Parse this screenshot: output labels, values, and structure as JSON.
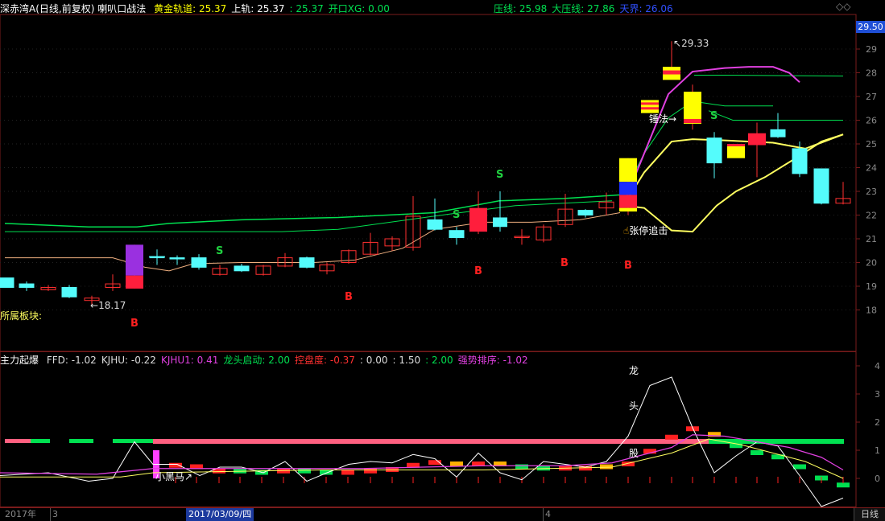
{
  "header": {
    "stock_name": "深赤湾A",
    "period_mode": "(日线,前复权)",
    "indicator_name": "喇叭口战法",
    "items": [
      {
        "label": "黄金轨道:",
        "value": "25.37",
        "color": "#ffff00"
      },
      {
        "label": "上轨:",
        "value": "25.37",
        "color": "#ffffff"
      },
      {
        "label": ":",
        "value": "25.37",
        "color": "#00e050"
      },
      {
        "label": "开口XG:",
        "value": "0.00",
        "color": "#00e050"
      }
    ],
    "right_items": [
      {
        "label": "压线:",
        "value": "25.98",
        "color": "#00e050"
      },
      {
        "label": "大压线:",
        "value": "27.86",
        "color": "#00e050"
      },
      {
        "label": "天界:",
        "value": "26.06",
        "color": "#3050ff"
      }
    ],
    "corner_icon": "diamond-icon"
  },
  "main_axis": {
    "ticks": [
      "29",
      "28",
      "27",
      "26",
      "25",
      "24",
      "23",
      "22",
      "21",
      "20",
      "19",
      "18"
    ],
    "current_price": "29.50"
  },
  "annotations": {
    "high_price": "29.33",
    "low_price": "18.17",
    "sector_label": "所属板块:",
    "hammer_label": "锤法→",
    "limit_up_label": "张停追击",
    "signals": {
      "buy": "B",
      "sell": "S"
    }
  },
  "sub_header": {
    "title": "主力起爆",
    "items": [
      {
        "label": "FFD:",
        "value": "-1.02",
        "color": "#dddddd"
      },
      {
        "label": "KJHU:",
        "value": "-0.22",
        "color": "#dddddd"
      },
      {
        "label": "KJHU1:",
        "value": "0.41",
        "color": "#e040e0"
      },
      {
        "label": "龙头启动:",
        "value": "2.00",
        "color": "#00e050"
      },
      {
        "label": "控盘度:",
        "value": "-0.37",
        "color": "#ff3030"
      },
      {
        "label": ":",
        "value": "0.00",
        "color": "#dddddd"
      },
      {
        "label": ":",
        "value": "1.50",
        "color": "#dddddd"
      },
      {
        "label": ":",
        "value": "2.00",
        "color": "#00e050"
      },
      {
        "label": "强势排序:",
        "value": "-1.02",
        "color": "#e040e0"
      }
    ]
  },
  "sub_axis": {
    "ticks": [
      "6",
      "4",
      "3",
      "2",
      "1",
      "0"
    ]
  },
  "sub_annotations": {
    "dragon_text": [
      "龙",
      "头",
      "股"
    ],
    "dark_horse_label": "小黑马↗"
  },
  "date_axis": {
    "year_label": "2017年",
    "month_labels": [
      "3",
      "4"
    ],
    "selected_date": "2017/03/09/四",
    "period_button": "日线"
  },
  "colors": {
    "up": "#ff3030",
    "down": "#54fcfc",
    "yellow": "#ffff00",
    "green": "#00e050",
    "magenta": "#e040e0",
    "pink_band": "#ff6080",
    "axis_border": "#7a1b1b"
  }
}
